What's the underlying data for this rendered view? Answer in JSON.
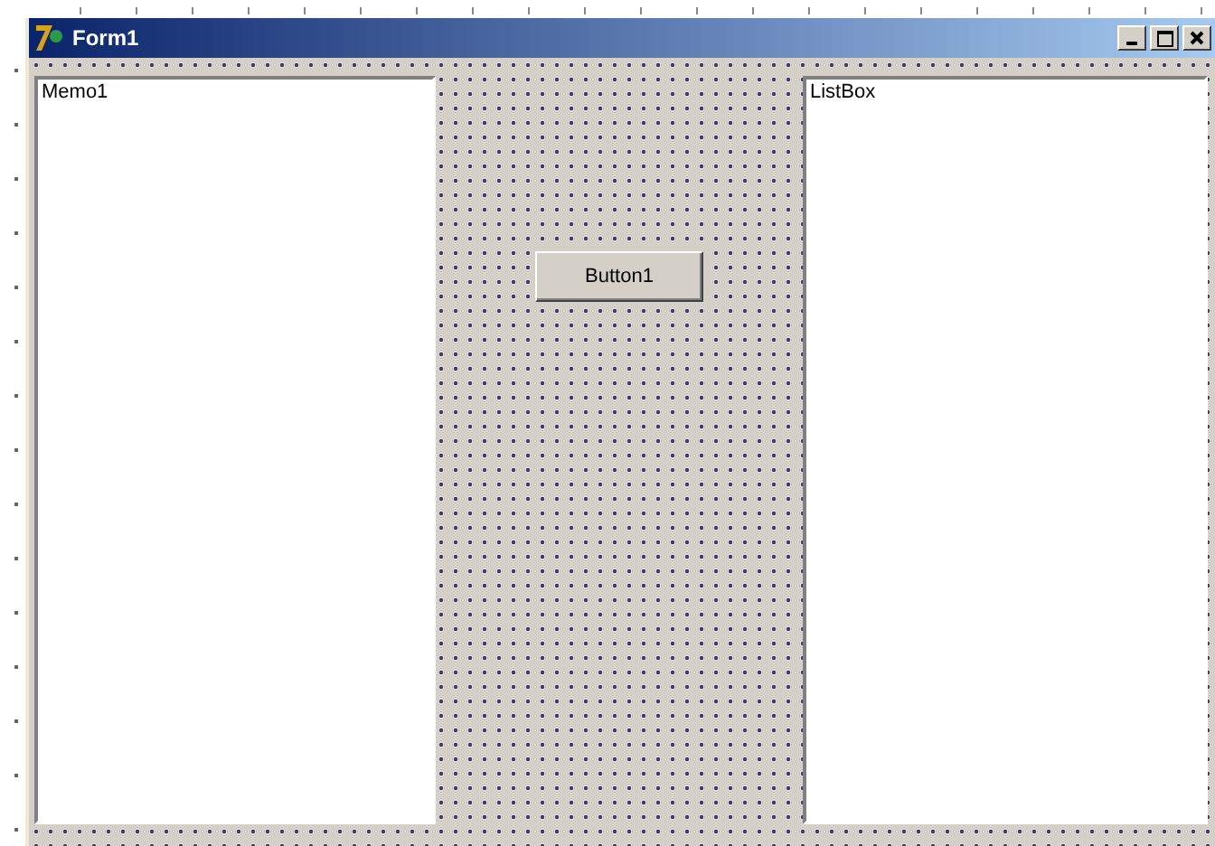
{
  "window": {
    "title": "Form1"
  },
  "memo": {
    "text": "Memo1"
  },
  "button": {
    "label": "Button1"
  },
  "listbox": {
    "text": "ListBox"
  }
}
